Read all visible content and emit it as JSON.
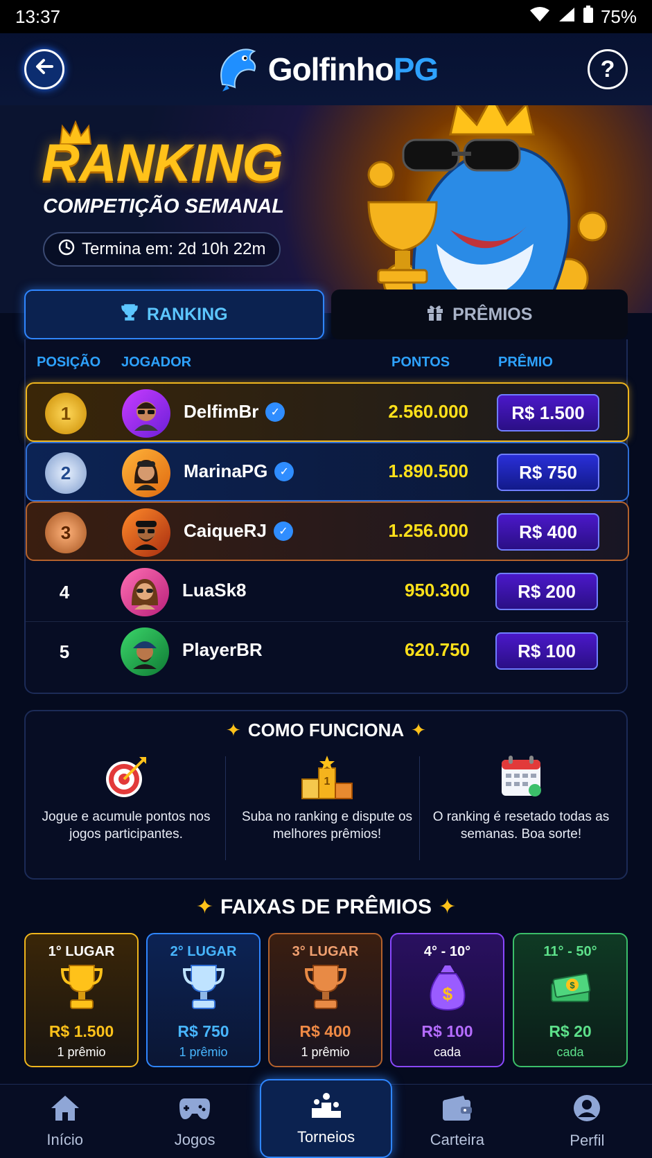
{
  "status_bar": {
    "time": "13:37",
    "battery": "75%"
  },
  "header": {
    "logo_part1": "Golfinho",
    "logo_part2": "PG"
  },
  "hero": {
    "title": "RANKING",
    "subtitle": "COMPETIÇÃO SEMANAL",
    "timer": "Termina em: 2d 10h 22m"
  },
  "tabs": {
    "ranking": "RANKING",
    "prizes": "PRÊMIOS"
  },
  "table": {
    "headers": {
      "position": "POSIÇÃO",
      "player": "JOGADOR",
      "points": "PONTOS",
      "prize": "PRÊMIO"
    },
    "rows": [
      {
        "pos": "1",
        "name": "DelfimBr",
        "points": "2.560.000",
        "prize": "R$ 1.500"
      },
      {
        "pos": "2",
        "name": "MarinaPG",
        "points": "1.890.500",
        "prize": "R$ 750"
      },
      {
        "pos": "3",
        "name": "CaiqueRJ",
        "points": "1.256.000",
        "prize": "R$ 400"
      },
      {
        "pos": "4",
        "name": "LuaSk8",
        "points": "950.300",
        "prize": "R$ 200"
      },
      {
        "pos": "5",
        "name": "PlayerBR",
        "points": "620.750",
        "prize": "R$ 100"
      }
    ]
  },
  "how": {
    "title": "COMO FUNCIONA",
    "steps": [
      {
        "text": "Jogue e acumule pontos nos jogos participantes."
      },
      {
        "text": "Suba no ranking e dispute os melhores prêmios!"
      },
      {
        "text": "O ranking é resetado todas as semanas. Boa sorte!"
      }
    ]
  },
  "tiers": {
    "title": "FAIXAS DE PRÊMIOS",
    "items": [
      {
        "label": "1° LUGAR",
        "value": "R$ 1.500",
        "count": "1 prêmio",
        "color": "#ffc21a"
      },
      {
        "label": "2° LUGAR",
        "value": "R$ 750",
        "count": "1 prêmio",
        "color": "#48b6ff"
      },
      {
        "label": "3° LUGAR",
        "value": "R$ 400",
        "count": "1 prêmio",
        "color": "#f08a45"
      },
      {
        "label": "4° - 10°",
        "value": "R$ 100",
        "count": "cada",
        "color": "#b56cff"
      },
      {
        "label": "11° - 50°",
        "value": "R$ 20",
        "count": "cada",
        "color": "#5de08a"
      }
    ]
  },
  "nav": {
    "home": "Início",
    "games": "Jogos",
    "tournaments": "Torneios",
    "wallet": "Carteira",
    "profile": "Perfil"
  }
}
